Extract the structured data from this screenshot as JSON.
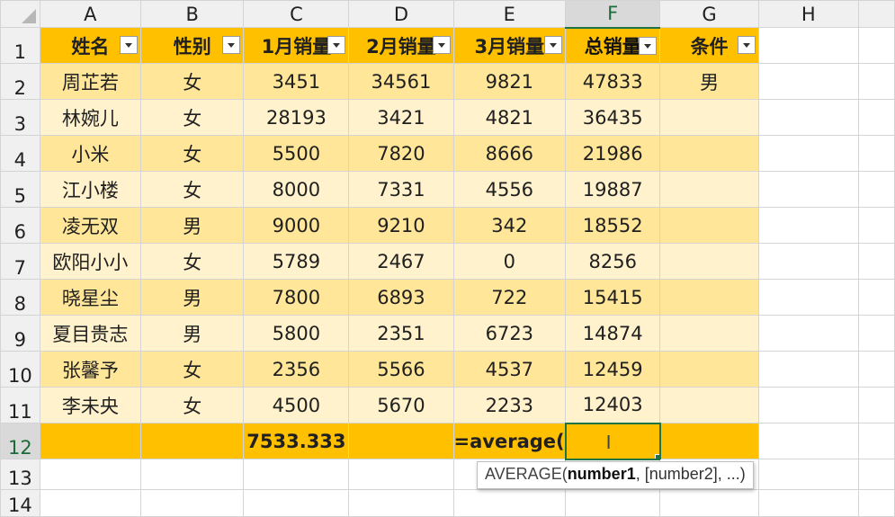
{
  "columns": [
    "A",
    "B",
    "C",
    "D",
    "E",
    "F",
    "G",
    "H"
  ],
  "row_numbers": [
    "1",
    "2",
    "3",
    "4",
    "5",
    "6",
    "7",
    "8",
    "9",
    "10",
    "11",
    "12",
    "13",
    "14"
  ],
  "headers": [
    "姓名",
    "性别",
    "1月销量",
    "2月销量",
    "3月销量",
    "总销量",
    "条件"
  ],
  "rows": [
    {
      "name": "周芷若",
      "gender": "女",
      "m1": "3451",
      "m2": "34561",
      "m3": "9821",
      "total": "47833",
      "cond": "男"
    },
    {
      "name": "林婉儿",
      "gender": "女",
      "m1": "28193",
      "m2": "3421",
      "m3": "4821",
      "total": "36435",
      "cond": ""
    },
    {
      "name": "小米",
      "gender": "女",
      "m1": "5500",
      "m2": "7820",
      "m3": "8666",
      "total": "21986",
      "cond": ""
    },
    {
      "name": "江小楼",
      "gender": "女",
      "m1": "8000",
      "m2": "7331",
      "m3": "4556",
      "total": "19887",
      "cond": ""
    },
    {
      "name": "凌无双",
      "gender": "男",
      "m1": "9000",
      "m2": "9210",
      "m3": "342",
      "total": "18552",
      "cond": ""
    },
    {
      "name": "欧阳小小",
      "gender": "女",
      "m1": "5789",
      "m2": "2467",
      "m3": "0",
      "total": "8256",
      "cond": ""
    },
    {
      "name": "晓星尘",
      "gender": "男",
      "m1": "7800",
      "m2": "6893",
      "m3": "722",
      "total": "15415",
      "cond": ""
    },
    {
      "name": "夏目贵志",
      "gender": "男",
      "m1": "5800",
      "m2": "2351",
      "m3": "6723",
      "total": "14874",
      "cond": ""
    },
    {
      "name": "张馨予",
      "gender": "女",
      "m1": "2356",
      "m2": "5566",
      "m3": "4537",
      "total": "12459",
      "cond": ""
    },
    {
      "name": "李未央",
      "gender": "女",
      "m1": "4500",
      "m2": "5670",
      "m3": "2233",
      "total": "12403",
      "cond": ""
    }
  ],
  "totals_row": {
    "c": "7533.333",
    "e": "=average("
  },
  "tooltip": {
    "func": "AVERAGE(",
    "arg1": "number1",
    "rest": ", [number2], ...)"
  },
  "active_column": "F",
  "active_row": "12",
  "colors": {
    "header_fill": "#ffc000",
    "band_dark": "#ffe699",
    "band_light": "#fff2cc",
    "selection": "#217346"
  }
}
